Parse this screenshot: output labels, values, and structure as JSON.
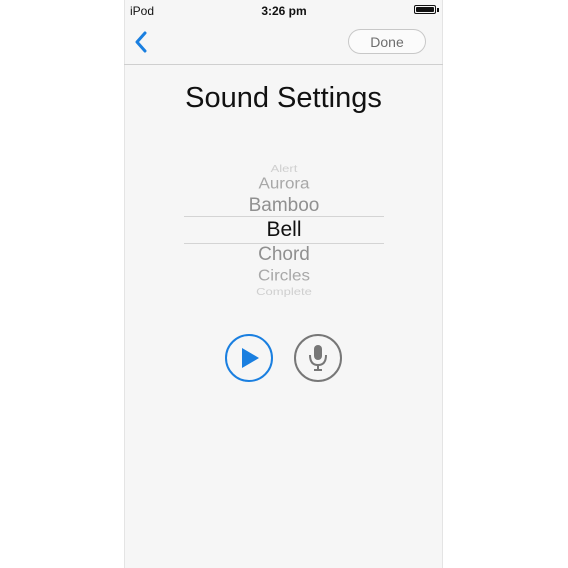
{
  "status_bar": {
    "carrier": "iPod",
    "time": "3:26 pm",
    "battery_level": 1.0
  },
  "nav": {
    "back_icon": "chevron-left-icon",
    "done_label": "Done"
  },
  "page": {
    "title": "Sound Settings"
  },
  "picker": {
    "items": [
      "Alert",
      "Aurora",
      "Bamboo",
      "Bell",
      "Chord",
      "Circles",
      "Complete"
    ],
    "selected": "Bell"
  },
  "controls": {
    "play_icon": "play-icon",
    "mic_icon": "microphone-icon"
  },
  "colors": {
    "accent": "#1a7fe0",
    "mic": "#777777",
    "background": "#f6f6f6"
  }
}
